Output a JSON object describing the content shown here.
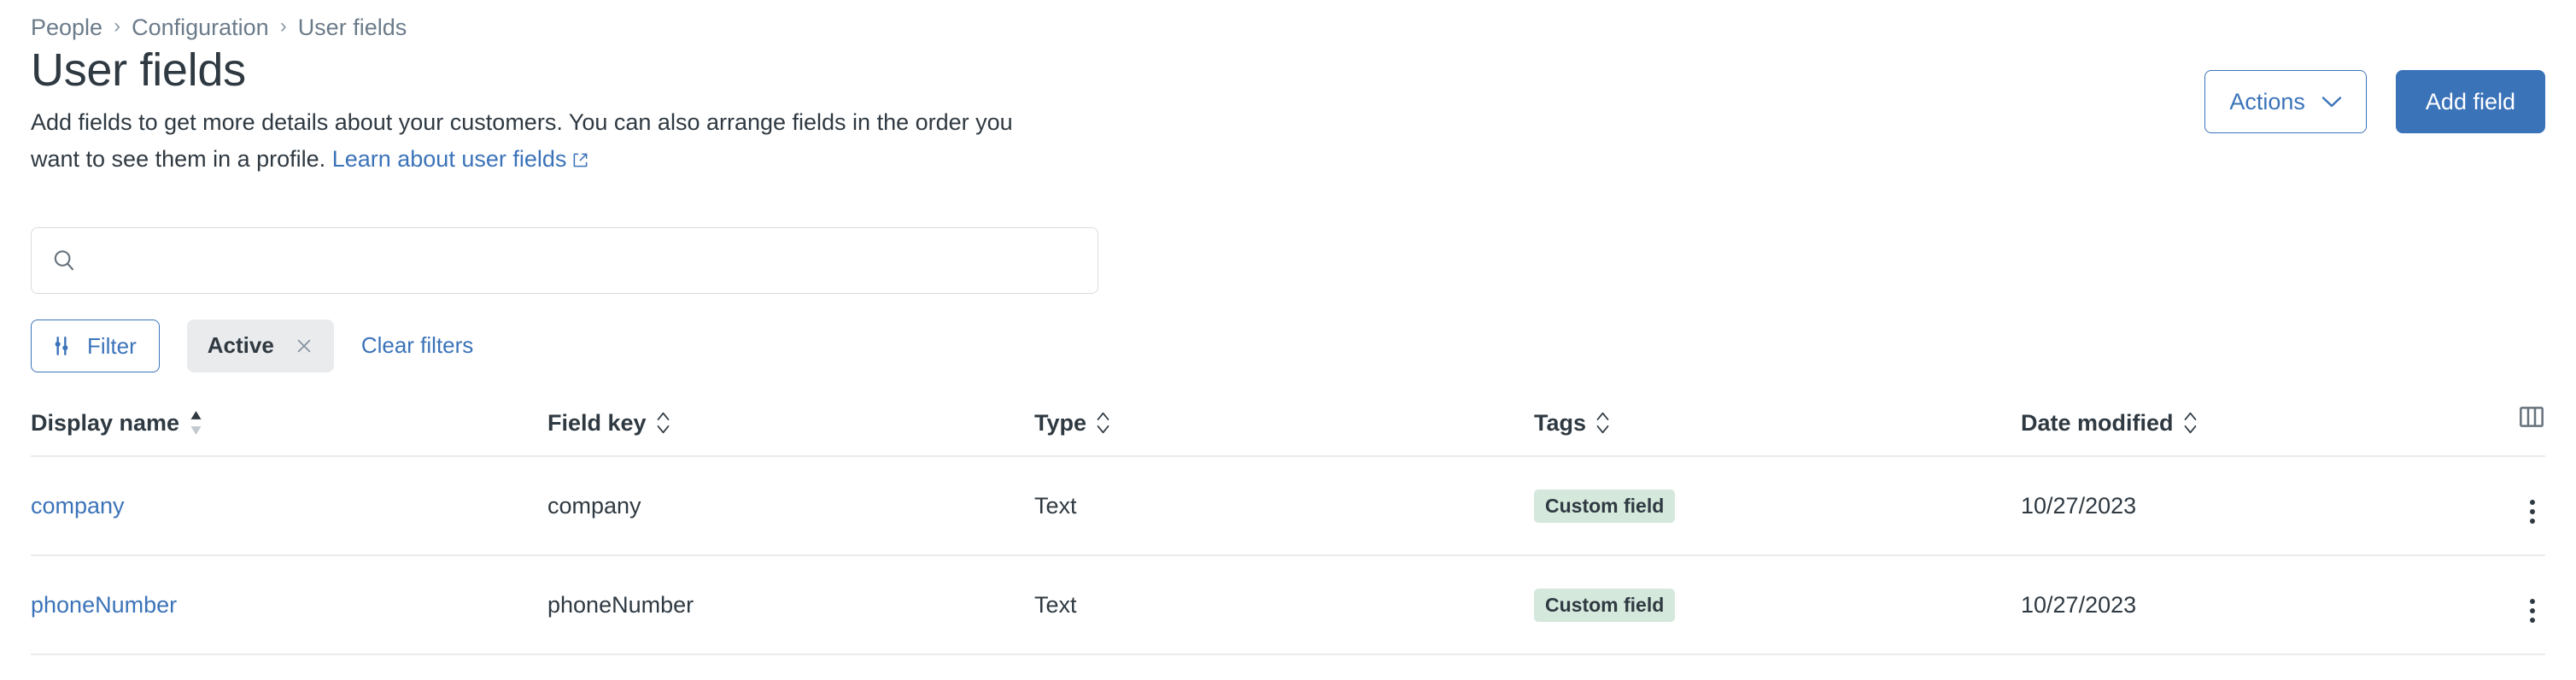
{
  "breadcrumb": {
    "items": [
      {
        "label": "People"
      },
      {
        "label": "Configuration"
      },
      {
        "label": "User fields"
      }
    ],
    "separator": "›"
  },
  "header": {
    "title": "User fields",
    "description_part1": "Add fields to get more details about your customers. You can also arrange fields in the order you want to see them in a profile.",
    "link_label": "Learn about user fields",
    "link_icon": "external-link-icon",
    "actions_label": "Actions",
    "actions_caret_icon": "chevron-down-icon",
    "add_field_label": "Add field"
  },
  "search": {
    "value": "",
    "placeholder": "",
    "icon": "search-icon"
  },
  "filters": {
    "filter_button_label": "Filter",
    "filter_icon": "sliders-icon",
    "chips": [
      {
        "label": "Active",
        "remove_icon": "close-icon"
      }
    ],
    "clear_label": "Clear filters"
  },
  "table": {
    "columns": [
      {
        "label": "Display name",
        "sort": "asc",
        "sort_icon": "sort-ascending-icon"
      },
      {
        "label": "Field key",
        "sort": "none",
        "sort_icon": "sort-icon"
      },
      {
        "label": "Type",
        "sort": "none",
        "sort_icon": "sort-icon"
      },
      {
        "label": "Tags",
        "sort": "none",
        "sort_icon": "sort-icon"
      },
      {
        "label": "Date modified",
        "sort": "none",
        "sort_icon": "sort-icon"
      }
    ],
    "column_settings_icon": "columns-layout-icon",
    "row_menu_icon": "more-vertical-icon",
    "rows": [
      {
        "display_name": "company",
        "field_key": "company",
        "type": "Text",
        "tag": "Custom field",
        "date_modified": "10/27/2023"
      },
      {
        "display_name": "phoneNumber",
        "field_key": "phoneNumber",
        "type": "Text",
        "tag": "Custom field",
        "date_modified": "10/27/2023"
      }
    ]
  },
  "colors": {
    "accent": "#3b73b9",
    "text": "#2f3941",
    "muted": "#6b7b8a",
    "border": "#e9ebed",
    "chip_bg": "#e9ebed",
    "tag_bg": "#d5e8dc"
  }
}
